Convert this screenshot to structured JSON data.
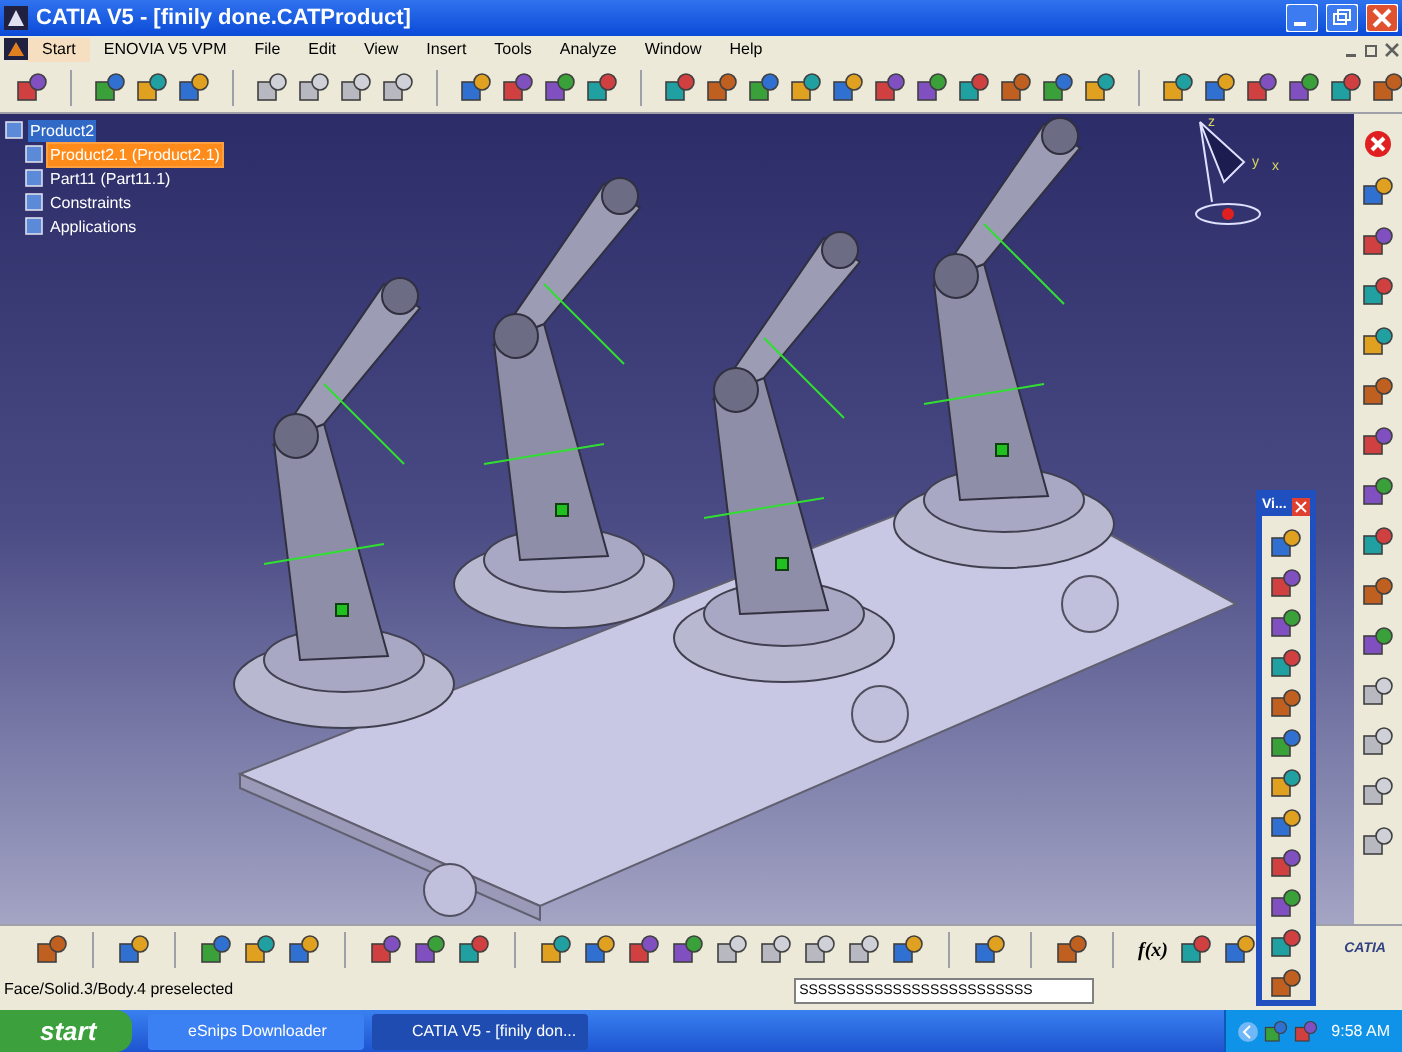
{
  "window": {
    "title": "CATIA V5 - [finily done.CATProduct]"
  },
  "menu": [
    {
      "label": "Start",
      "selected": true
    },
    {
      "label": "ENOVIA V5 VPM",
      "selected": false
    },
    {
      "label": "File",
      "selected": false
    },
    {
      "label": "Edit",
      "selected": false
    },
    {
      "label": "View",
      "selected": false
    },
    {
      "label": "Insert",
      "selected": false
    },
    {
      "label": "Tools",
      "selected": false
    },
    {
      "label": "Analyze",
      "selected": false
    },
    {
      "label": "Window",
      "selected": false
    },
    {
      "label": "Help",
      "selected": false
    }
  ],
  "tree": [
    {
      "label": "Product2",
      "selected": true,
      "preselected": false,
      "children": [
        {
          "label": "Product2.1 (Product2.1)",
          "selected": false,
          "preselected": true
        },
        {
          "label": "Part11 (Part11.1)",
          "selected": false,
          "preselected": false
        },
        {
          "label": "Constraints",
          "selected": false,
          "preselected": false
        },
        {
          "label": "Applications",
          "selected": false,
          "preselected": false
        }
      ]
    }
  ],
  "compass": {
    "labels": [
      "z",
      "y",
      "x"
    ]
  },
  "view_toolbar": {
    "title": "Vi..."
  },
  "bottom_toolbar": {
    "formula": "f(x)"
  },
  "logo": {
    "text": "CATIA"
  },
  "status_bar": {
    "message": "Face/Solid.3/Body.4 preselected",
    "command_input": "SSSSSSSSSSSSSSSSSSSSSSSSS"
  },
  "taskbar": {
    "start": "start",
    "tasks": [
      {
        "label": "eSnips Downloader",
        "selected": false
      },
      {
        "label": "CATIA V5 - [finily don...",
        "selected": true
      }
    ],
    "clock": "9:58 AM"
  }
}
